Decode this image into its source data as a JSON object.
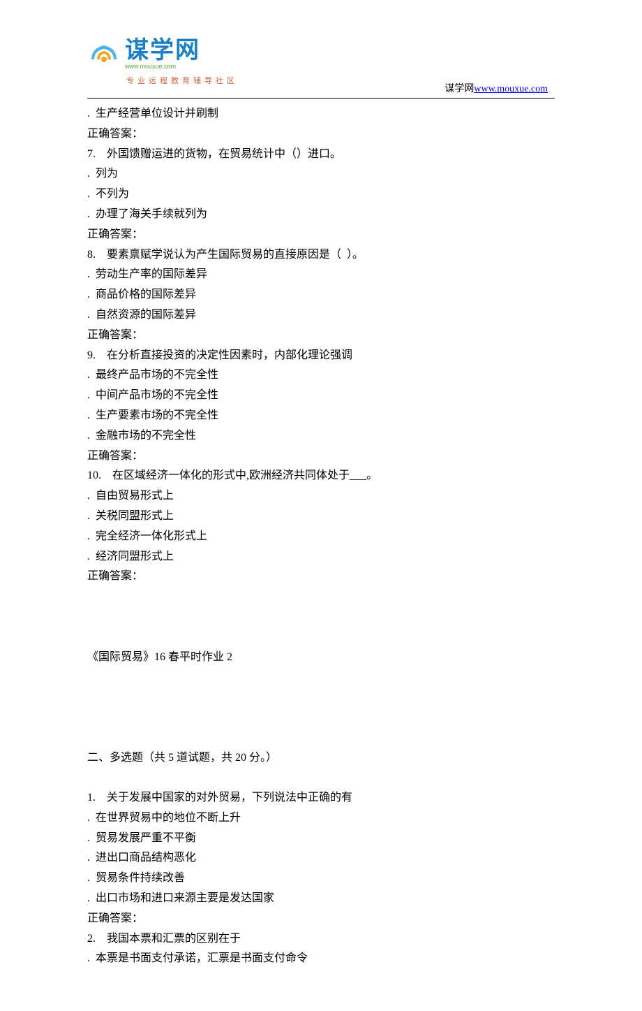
{
  "logo": {
    "main": "谋学网",
    "sub": "www.mouxue.com",
    "tagline": "专业远程教育辅导社区"
  },
  "header": {
    "site_label": "谋学网",
    "site_url": "www.mouxue.com"
  },
  "lines": [
    ".  生产经营单位设计并刷制",
    "正确答案：",
    "7.    外国馈赠运进的货物，在贸易统计中（）进口。",
    ".  列为",
    ".  不列为",
    ".  办理了海关手续就列为",
    "正确答案：",
    "8.    要素禀赋学说认为产生国际贸易的直接原因是（  ）。",
    ".  劳动生产率的国际差异",
    ".  商品价格的国际差异",
    ".  自然资源的国际差异",
    "正确答案：",
    "9.    在分析直接投资的决定性因素时，内部化理论强调",
    ".  最终产品市场的不完全性",
    ".  中间产品市场的不完全性",
    ".  生产要素市场的不完全性",
    ".  金融市场的不完全性",
    "正确答案：",
    "10.    在区域经济一体化的形式中,欧洲经济共同体处于___。",
    ".  自由贸易形式上",
    ".  关税同盟形式上",
    ".  完全经济一体化形式上",
    ".  经济同盟形式上",
    "正确答案：",
    "",
    "",
    "",
    "《国际贸易》16 春平时作业 2",
    "",
    "",
    "",
    "",
    "二、多选题（共 5 道试题，共 20 分。）",
    "",
    "1.    关于发展中国家的对外贸易，下列说法中正确的有",
    ".  在世界贸易中的地位不断上升",
    ".  贸易发展严重不平衡",
    ".  进出口商品结构恶化",
    ".  贸易条件持续改善",
    ".  出口市场和进口来源主要是发达国家",
    "正确答案：",
    "2.    我国本票和汇票的区别在于",
    ".  本票是书面支付承诺，汇票是书面支付命令"
  ]
}
